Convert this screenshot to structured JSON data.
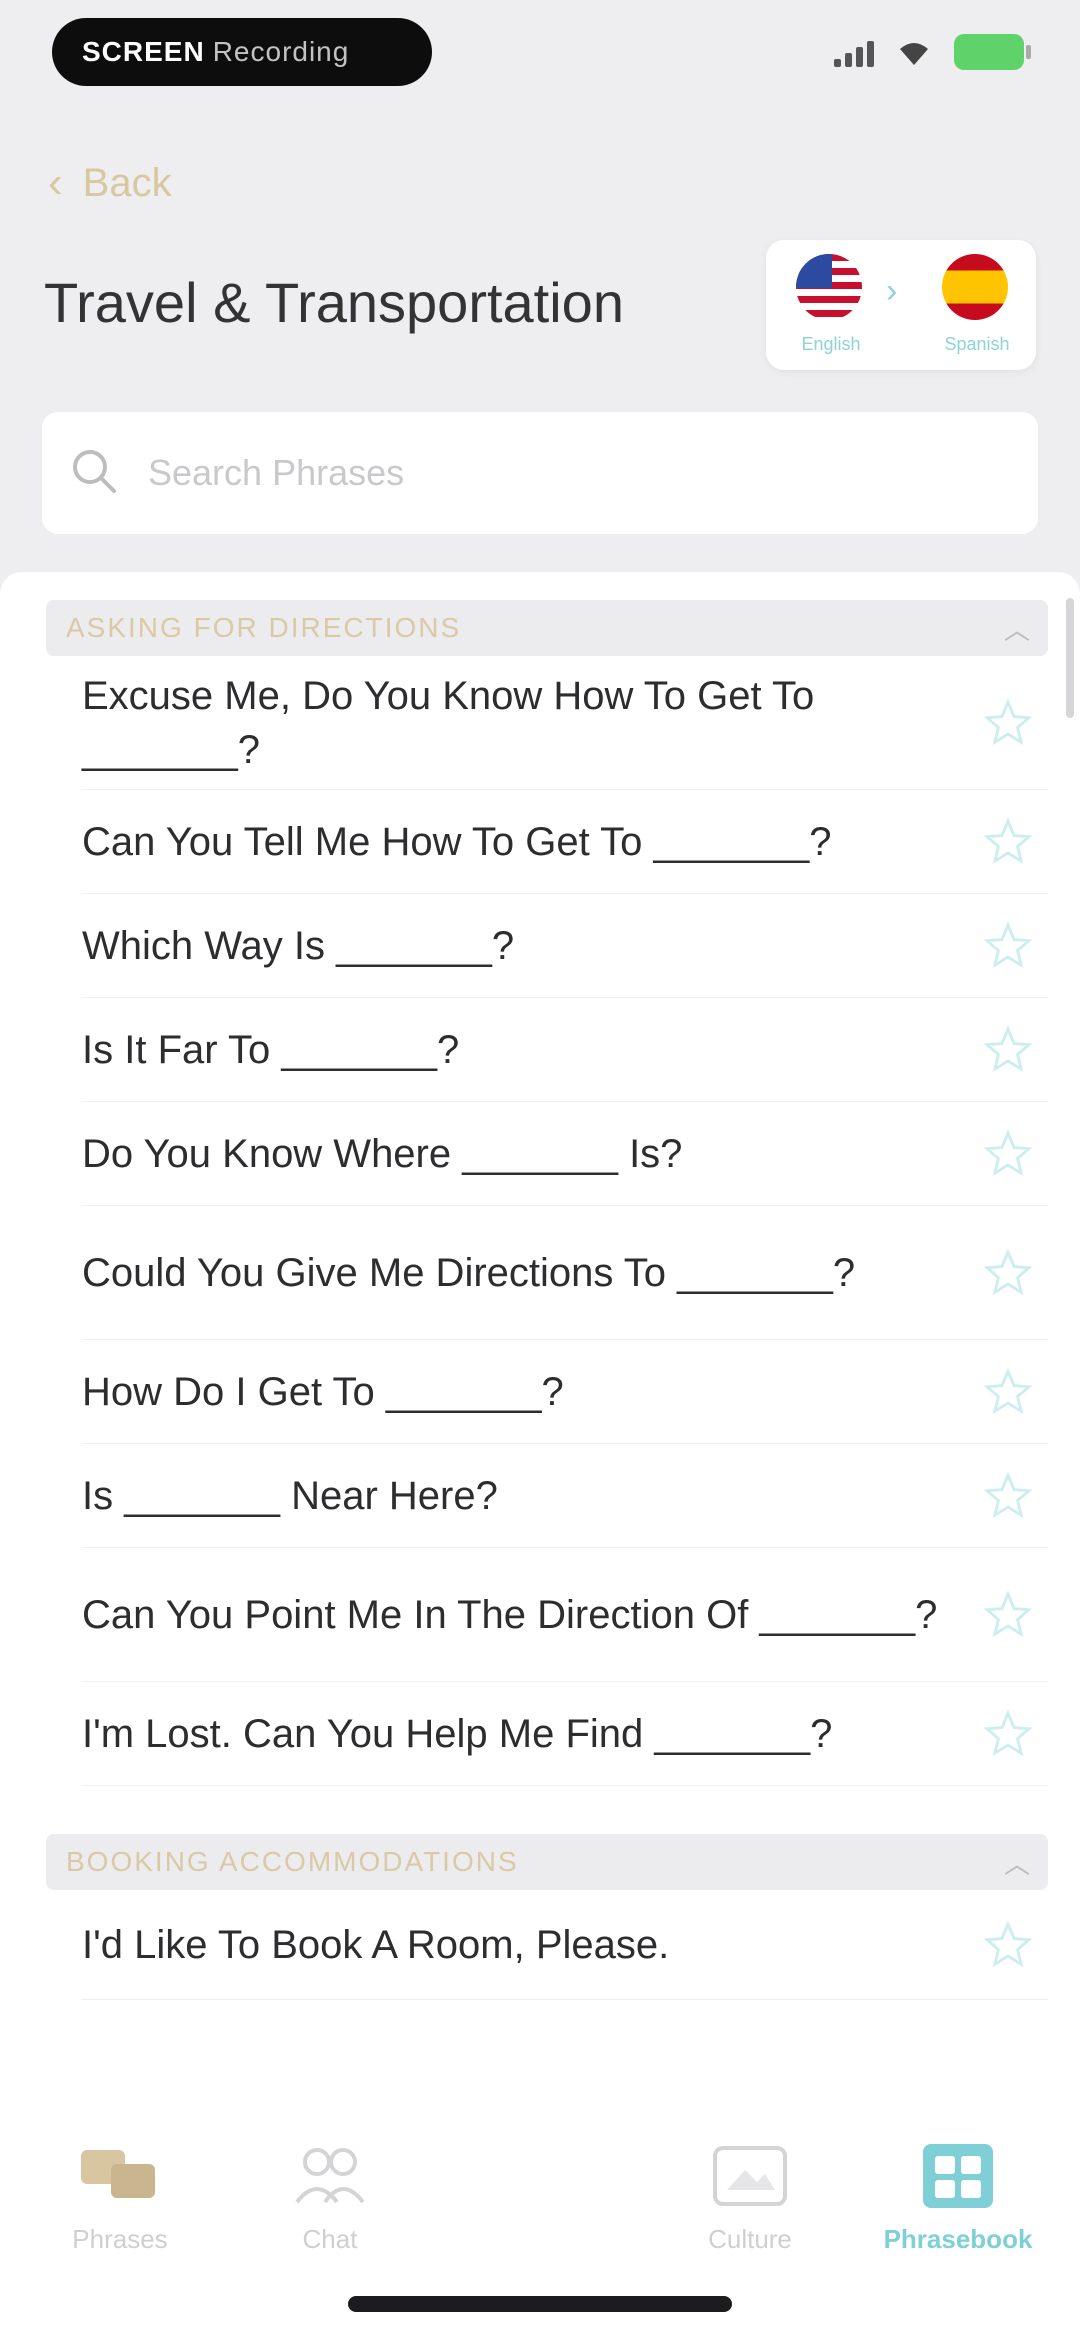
{
  "status": {
    "pill_text": "SCREEN",
    "pill_sub": "Recording"
  },
  "header": {
    "back_label": "Back",
    "title": "Travel & Transportation"
  },
  "language": {
    "source": "English",
    "target": "Spanish",
    "arrow": "›"
  },
  "search": {
    "placeholder": "Search Phrases"
  },
  "sections": [
    {
      "title": "ASKING FOR DIRECTIONS",
      "phrases": [
        "Excuse Me, Do You Know How To Get To _______?",
        "Can You Tell Me How To Get To _______?",
        "Which Way Is _______?",
        "Is It Far To _______?",
        "Do You Know Where _______ Is?",
        "Could You Give Me Directions To _______?",
        "How Do I Get To _______?",
        "Is _______ Near Here?",
        "Can You Point Me In The Direction Of _______?",
        "I'm Lost. Can You Help Me Find _______?"
      ]
    },
    {
      "title": "BOOKING ACCOMMODATIONS",
      "phrases": [
        "I'd Like To Book A Room, Please."
      ]
    }
  ],
  "tabs": [
    {
      "label": "Phrases",
      "icon": "phrases-icon",
      "active": false
    },
    {
      "label": "Chat",
      "icon": "chat-icon",
      "active": false
    },
    {
      "label": "Culture",
      "icon": "culture-icon",
      "active": false
    },
    {
      "label": "Phrasebook",
      "icon": "phrasebook-icon",
      "active": true
    }
  ],
  "colors": {
    "accent": "#7fd0d6",
    "gold": "#d9c9a6",
    "star": "#cdeef0"
  }
}
